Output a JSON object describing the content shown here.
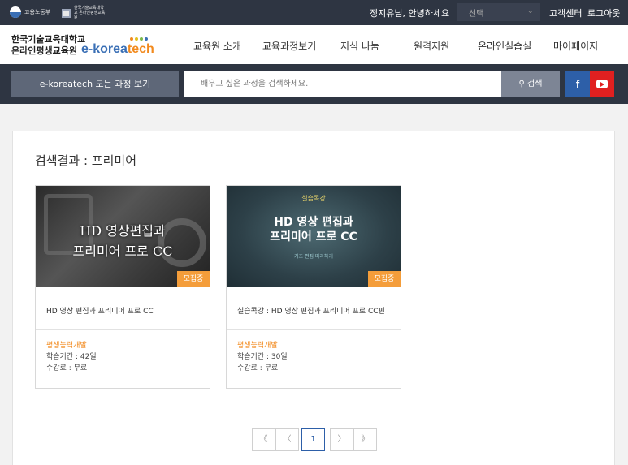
{
  "topbar": {
    "moel_logo_text": "고용노동부",
    "koreatech_logo_text": "한국기술교육대학교 온라인평생교육원",
    "greeting": "정지유님, 안녕하세요",
    "select_value": "선택",
    "customer_center": "고객센터",
    "logout": "로그아웃"
  },
  "header": {
    "brand_line1": "한국기술교육대학교",
    "brand_line2": "온라인평생교육원",
    "brand_en_1": "e-korea",
    "brand_en_2": "tech",
    "nav": [
      "교육원 소개",
      "교육과정보기",
      "지식 나눔",
      "원격지원",
      "온라인실습실",
      "마이페이지"
    ]
  },
  "search": {
    "all_courses": "e-koreatech 모든 과정 보기",
    "placeholder": "배우고 싶은 과정을 검색하세요.",
    "button": "검색",
    "facebook": "f"
  },
  "main": {
    "result_title": "검색결과 : 프리미어",
    "cards": [
      {
        "thumb_line1": "HD 영상편집과",
        "thumb_line2": "프리미어 프로 CC",
        "badge": "모집중",
        "title": "HD 영상 편집과 프리미어 프로 CC",
        "category": "평생능력개발",
        "period": "학습기간 : 42일",
        "fee": "수강료 : 무료"
      },
      {
        "thumb_tag": "실습콕강",
        "thumb_line1": "HD 영상 편집과",
        "thumb_line2": "프리미어 프로 CC",
        "thumb_sub": "기초 편집 따라하기",
        "badge": "모집중",
        "title": "실습콕강 : HD 영상 편집과 프리미어 프로 CC편",
        "category": "평생능력개발",
        "period": "학습기간 : 30일",
        "fee": "수강료 : 무료"
      }
    ]
  },
  "pagination": {
    "first": "《",
    "prev": "〈",
    "current": "1",
    "next": "〉",
    "last": "》"
  },
  "colors": {
    "dark_bar": "#2e3542",
    "accent_orange": "#f28a1e",
    "badge_orange": "#f49d3a",
    "brand_blue": "#3a6fb5",
    "facebook": "#2d5fa8",
    "youtube": "#e02020"
  }
}
